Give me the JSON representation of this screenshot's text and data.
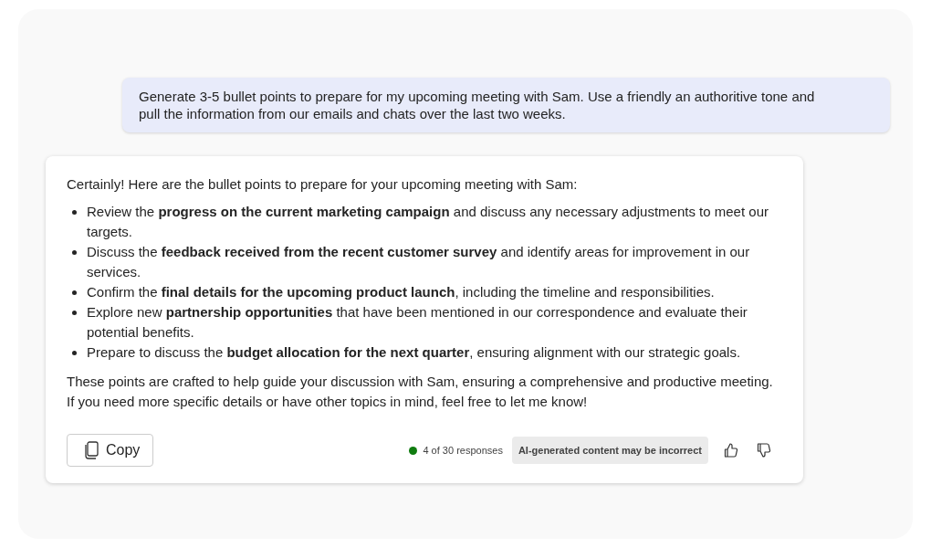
{
  "prompt": {
    "text": "Generate 3-5 bullet points to prepare for my upcoming meeting with Sam. Use a friendly an authoritive tone and pull the information from our emails and chats over the last two weeks."
  },
  "response": {
    "intro": "Certainly! Here are the bullet points to prepare for your upcoming meeting with Sam:",
    "bullets": [
      "Review the **progress on the current marketing campaign** and discuss any necessary adjustments to meet our targets.",
      "Discuss the **feedback received from the recent customer survey** and identify areas for improvement in our services.",
      "Confirm the **final details for the upcoming product launch**, including the timeline and responsibilities.",
      "Explore new **partnership opportunities** that have been mentioned in our correspondence and evaluate their potential benefits.",
      "Prepare to discuss the **budget allocation for the next quarter**, ensuring alignment with our strategic goals."
    ],
    "outro": "These points are crafted to help guide your discussion with Sam, ensuring a comprehensive and productive meeting. If you need more specific details or have other topics in mind, feel free to let me know!"
  },
  "footer": {
    "copy_label": "Copy",
    "responses": "4 of 30 responses",
    "disclaimer": "AI-generated content may be incorrect"
  }
}
